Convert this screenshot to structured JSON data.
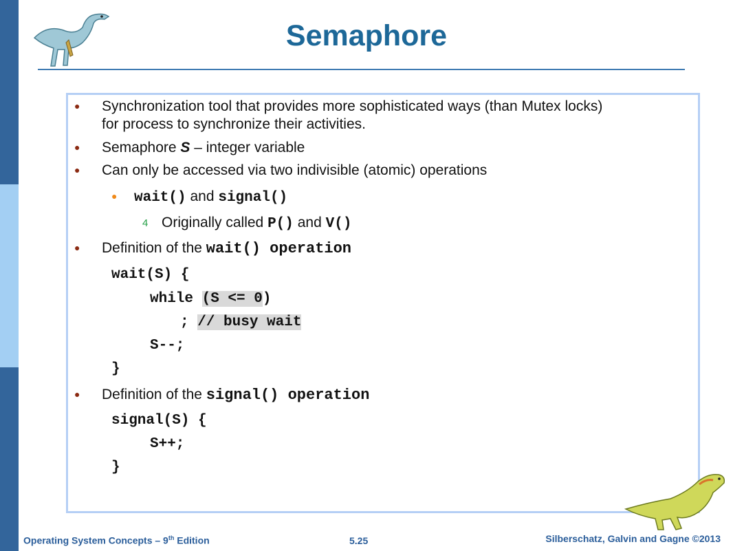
{
  "slide": {
    "title": "Semaphore"
  },
  "bullets": {
    "b1_line1": "Synchronization tool that provides more sophisticated ways (than Mutex locks)",
    "b1_line2": "for process to synchronize their activities.",
    "b2_prefix": "Semaphore ",
    "b2_symbol": "S",
    "b2_suffix": " – integer variable",
    "b3": "Can only be accessed via two indivisible (atomic) operations",
    "sub_wait": "wait()",
    "sub_and": " and ",
    "sub_signal": "signal()",
    "num_marker": "4",
    "num_text": "Originally called ",
    "num_p": "P()",
    "num_and": " and ",
    "num_v": "V()",
    "b4_prefix": "Definition of  the ",
    "b4_code": "wait() operation",
    "b5_prefix": "Definition of  the ",
    "b5_code": "signal() operation"
  },
  "code_wait": {
    "l1": "wait(S) {",
    "l2_a": "while ",
    "l2_b": "(S <= 0",
    "l2_c": ")",
    "l3_a": "; ",
    "l3_b": "// busy wait",
    "l4": "S--;",
    "l5": "}"
  },
  "code_signal": {
    "l1": "signal(S) {",
    "l2": "S++;",
    "l3": "}"
  },
  "footer": {
    "left_prefix": "Operating System Concepts – 9",
    "left_sup": "th",
    "left_suffix": " Edition",
    "page": "5.25",
    "right": "Silberschatz, Galvin and Gagne ©2013"
  },
  "colors": {
    "title": "#1d6898",
    "left_bar": "#33659b",
    "left_bar_highlight": "#a3cff3",
    "box_border": "#b5cff5",
    "bullet": "#8b2a12",
    "sub_bullet": "#f08a1a",
    "num_bullet": "#27a048",
    "footer": "#2a5d9a"
  }
}
